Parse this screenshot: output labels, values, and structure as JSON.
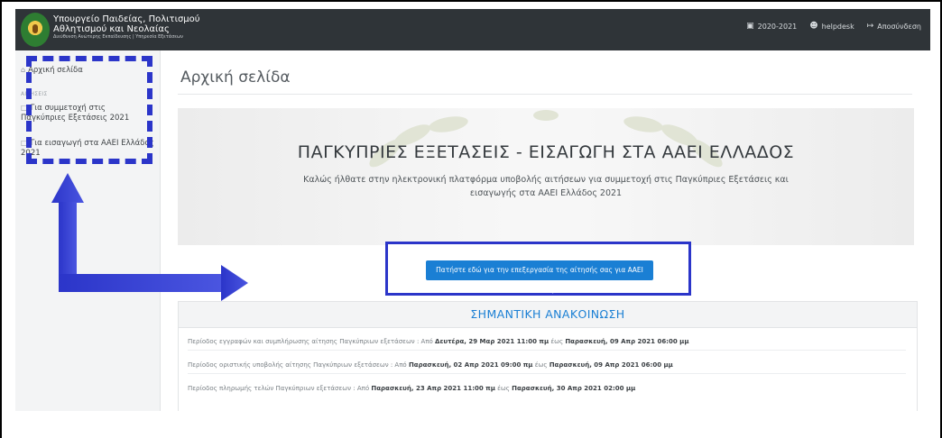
{
  "header": {
    "ministry_line1": "Υπουργείο Παιδείας, Πολιτισμού",
    "ministry_line2": "Αθλητισμού και Νεολαίας",
    "ministry_sub": "Διεύθυνση Ανώτερης Εκπαίδευσης | Υπηρεσία Εξετάσεων",
    "year": "2020-2021",
    "user": "helpdesk",
    "logout": "Αποσύνδεση",
    "icons": {
      "year": "calendar-icon",
      "user": "user-icon",
      "logout": "logout-icon"
    }
  },
  "sidebar": {
    "home": "Αρχική σελίδα",
    "section": "ΑΙΤΗΣΕΙΣ",
    "items": [
      {
        "label": "Για συμμετοχή στις Παγκύπριες Εξετάσεις 2021"
      },
      {
        "label": "Για εισαγωγή στα ΑΑΕΙ Ελλάδος 2021"
      }
    ]
  },
  "main": {
    "page_title": "Αρχική σελίδα",
    "hero_title": "ΠΑΓΚΥΠΡΙΕΣ ΕΞΕΤΑΣΕΙΣ - ΕΙΣΑΓΩΓΗ ΣΤΑ ΑΑΕΙ ΕΛΛΑΔΟΣ",
    "hero_subtitle": "Καλώς ήλθατε στην ηλεκτρονική πλατφόρμα υποβολής αιτήσεων για συμμετοχή στις Παγκύπριες Εξετάσεις και εισαγωγής στα ΑΑΕΙ Ελλάδος 2021",
    "cta_label": "Πατήστε εδώ για την επεξεργασία της αίτησής σας για ΑΑΕΙ Ελλάδας",
    "announcement_title": "ΣΗΜΑΝΤΙΚΗ ΑΝΑΚΟΙΝΩΣΗ",
    "announcements": [
      {
        "text": "Περίοδος εγγραφών και συμπλήρωσης αίτησης Παγκύπριων εξετάσεων : Από ",
        "from": "Δευτέρα, 29 Μαρ 2021 11:00 πμ",
        "mid": " έως ",
        "to": "Παρασκευή, 09 Απρ 2021 06:00 μμ"
      },
      {
        "text": "Περίοδος οριστικής υποβολής αίτησης Παγκύπριων εξετάσεων : Από ",
        "from": "Παρασκευή, 02 Απρ 2021 09:00 πμ",
        "mid": " έως ",
        "to": "Παρασκευή, 09 Απρ 2021 06:00 μμ"
      },
      {
        "text": "Περίοδος πληρωμής τελών Παγκύπριων εξετάσεων : Από ",
        "from": "Παρασκευή, 23 Απρ 2021 11:00 πμ",
        "mid": " έως ",
        "to": "Παρασκευή, 30 Απρ 2021 02:00 μμ"
      }
    ]
  },
  "colors": {
    "header_bg": "#2f3438",
    "accent": "#1a7fd4",
    "highlight": "#2b35c9"
  }
}
